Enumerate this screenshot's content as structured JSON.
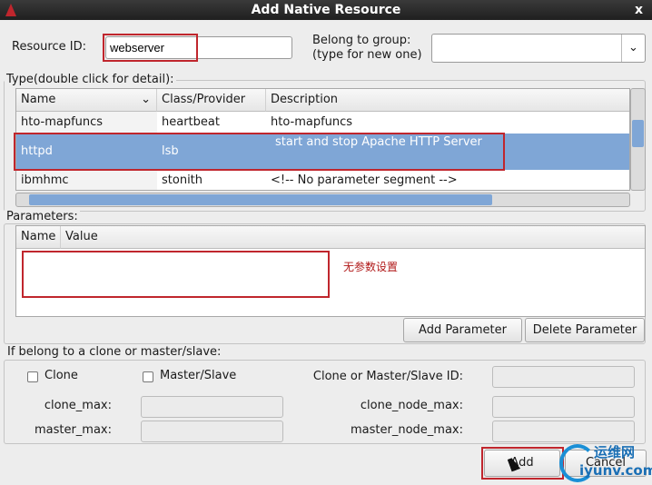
{
  "window": {
    "title": "Add Native Resource",
    "close_label": "x"
  },
  "resource_id": {
    "label": "Resource ID:",
    "value": "webserver"
  },
  "group": {
    "label_line1": "Belong to group:",
    "label_line2": "(type for new one)",
    "value": ""
  },
  "type_section": {
    "legend": "Type(double click for detail):",
    "columns": [
      "Name",
      "Class/Provider",
      "Description"
    ],
    "rows": [
      {
        "name": "hto-mapfuncs",
        "class": "heartbeat",
        "description": "hto-mapfuncs"
      },
      {
        "name": "httpd",
        "class": "lsb",
        "description": "start and stop Apache HTTP Server",
        "selected": true
      },
      {
        "name": "ibmhmc",
        "class": "stonith",
        "description": "<!-- No parameter segment -->"
      }
    ]
  },
  "parameters": {
    "legend": "Parameters:",
    "columns": [
      "Name",
      "Value"
    ],
    "annotation": "无参数设置",
    "add_label": "Add Parameter",
    "delete_label": "Delete Parameter"
  },
  "clone": {
    "legend": "If belong to a clone or master/slave:",
    "clone_label": "Clone",
    "clone_checked": false,
    "ms_label": "Master/Slave",
    "ms_checked": false,
    "id_label": "Clone or Master/Slave ID:",
    "clone_max_label": "clone_max:",
    "master_max_label": "master_max:",
    "clone_node_max_label": "clone_node_max:",
    "master_node_max_label": "master_node_max:"
  },
  "footer": {
    "add_label": "Add",
    "cancel_label": "Cancel"
  },
  "watermark": {
    "text1": "运维网",
    "text2": "iyunv.com"
  },
  "colors": {
    "selection": "#7fa6d6",
    "highlight": "#c0262d",
    "annotation": "#b01818"
  }
}
